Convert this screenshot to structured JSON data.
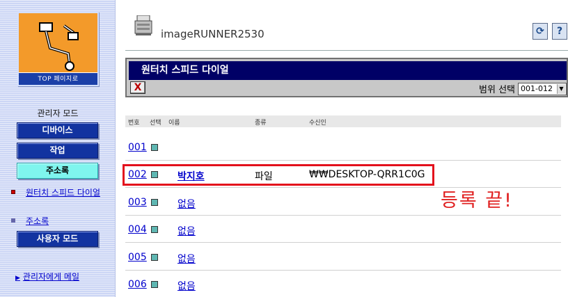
{
  "sidebar": {
    "top_page_label": "TOP 페이지로",
    "admin_mode_label": "관리자 모드",
    "buttons": [
      {
        "label": "디바이스",
        "active": false
      },
      {
        "label": "작업",
        "active": false
      },
      {
        "label": "주소록",
        "active": true
      }
    ],
    "links": [
      {
        "label": "원터치 스피드 다이얼",
        "bullet_color": "#cc0000"
      },
      {
        "label": "주소록",
        "bullet_color": "#6666aa"
      }
    ],
    "user_mode_label": "사용자 모드",
    "mail_link": "관리자에게 메일"
  },
  "header": {
    "device_name": "imageRUNNER2530",
    "refresh_icon": "refresh-icon",
    "help_icon": "help-icon",
    "help_label": "?"
  },
  "dialog": {
    "title": "원터치 스피드 다이얼",
    "close_label": "X",
    "range_label": "범위 선택",
    "range_value": "001-012"
  },
  "table": {
    "headers": [
      "번호",
      "선택",
      "이름",
      "종류",
      "수신인"
    ],
    "rows": [
      {
        "number": "001",
        "name": "",
        "type": "",
        "destination": ""
      },
      {
        "number": "002",
        "name": "박지호",
        "type": "파일",
        "destination": "₩₩DESKTOP-QRR1C0G"
      },
      {
        "number": "003",
        "name": "없음",
        "type": "",
        "destination": ""
      },
      {
        "number": "004",
        "name": "없음",
        "type": "",
        "destination": ""
      },
      {
        "number": "005",
        "name": "없음",
        "type": "",
        "destination": ""
      },
      {
        "number": "006",
        "name": "없음",
        "type": "",
        "destination": ""
      }
    ]
  },
  "annotation": {
    "text": "등록 끝!",
    "color": "#e02020"
  }
}
